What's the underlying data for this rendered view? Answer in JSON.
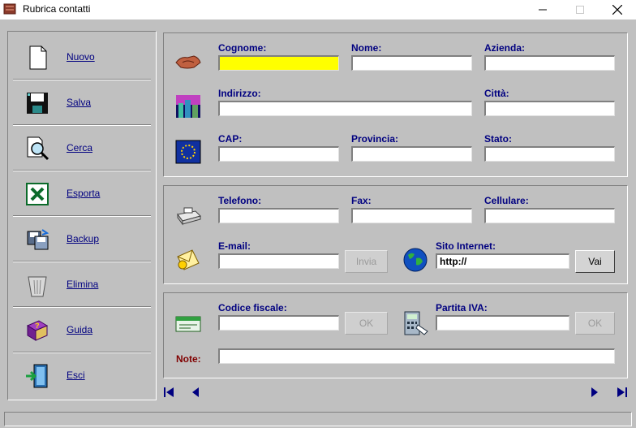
{
  "window": {
    "title": "Rubrica contatti"
  },
  "sidebar": {
    "items": [
      {
        "label": "Nuovo",
        "icon": "new-document-icon"
      },
      {
        "label": "Salva",
        "icon": "floppy-disk-icon"
      },
      {
        "label": "Cerca",
        "icon": "search-magnifier-icon"
      },
      {
        "label": "Esporta",
        "icon": "excel-icon"
      },
      {
        "label": "Backup",
        "icon": "backup-icon"
      },
      {
        "label": "Elimina",
        "icon": "trash-icon"
      },
      {
        "label": "Guida",
        "icon": "help-book-icon"
      },
      {
        "label": "Esci",
        "icon": "exit-door-icon"
      }
    ]
  },
  "anagrafica": {
    "cognome_label": "Cognome:",
    "cognome_value": "",
    "nome_label": "Nome:",
    "nome_value": "",
    "azienda_label": "Azienda:",
    "azienda_value": "",
    "indirizzo_label": "Indirizzo:",
    "indirizzo_value": "",
    "citta_label": "Città:",
    "citta_value": "",
    "cap_label": "CAP:",
    "cap_value": "",
    "provincia_label": "Provincia:",
    "provincia_value": "",
    "stato_label": "Stato:",
    "stato_value": ""
  },
  "contatti": {
    "telefono_label": "Telefono:",
    "telefono_value": "",
    "fax_label": "Fax:",
    "fax_value": "",
    "cellulare_label": "Cellulare:",
    "cellulare_value": "",
    "email_label": "E-mail:",
    "email_value": "",
    "invia_label": "Invia",
    "sito_label": "Sito Internet:",
    "sito_value": "http://",
    "vai_label": "Vai"
  },
  "fiscale": {
    "cf_label": "Codice fiscale:",
    "cf_value": "",
    "ok_label": "OK",
    "piva_label": "Partita IVA:",
    "piva_value": "",
    "note_label": "Note:",
    "note_value": ""
  },
  "colors": {
    "label": "#000080",
    "note_label": "#800000",
    "active_field": "#ffff00",
    "background": "#c0c0c0"
  }
}
